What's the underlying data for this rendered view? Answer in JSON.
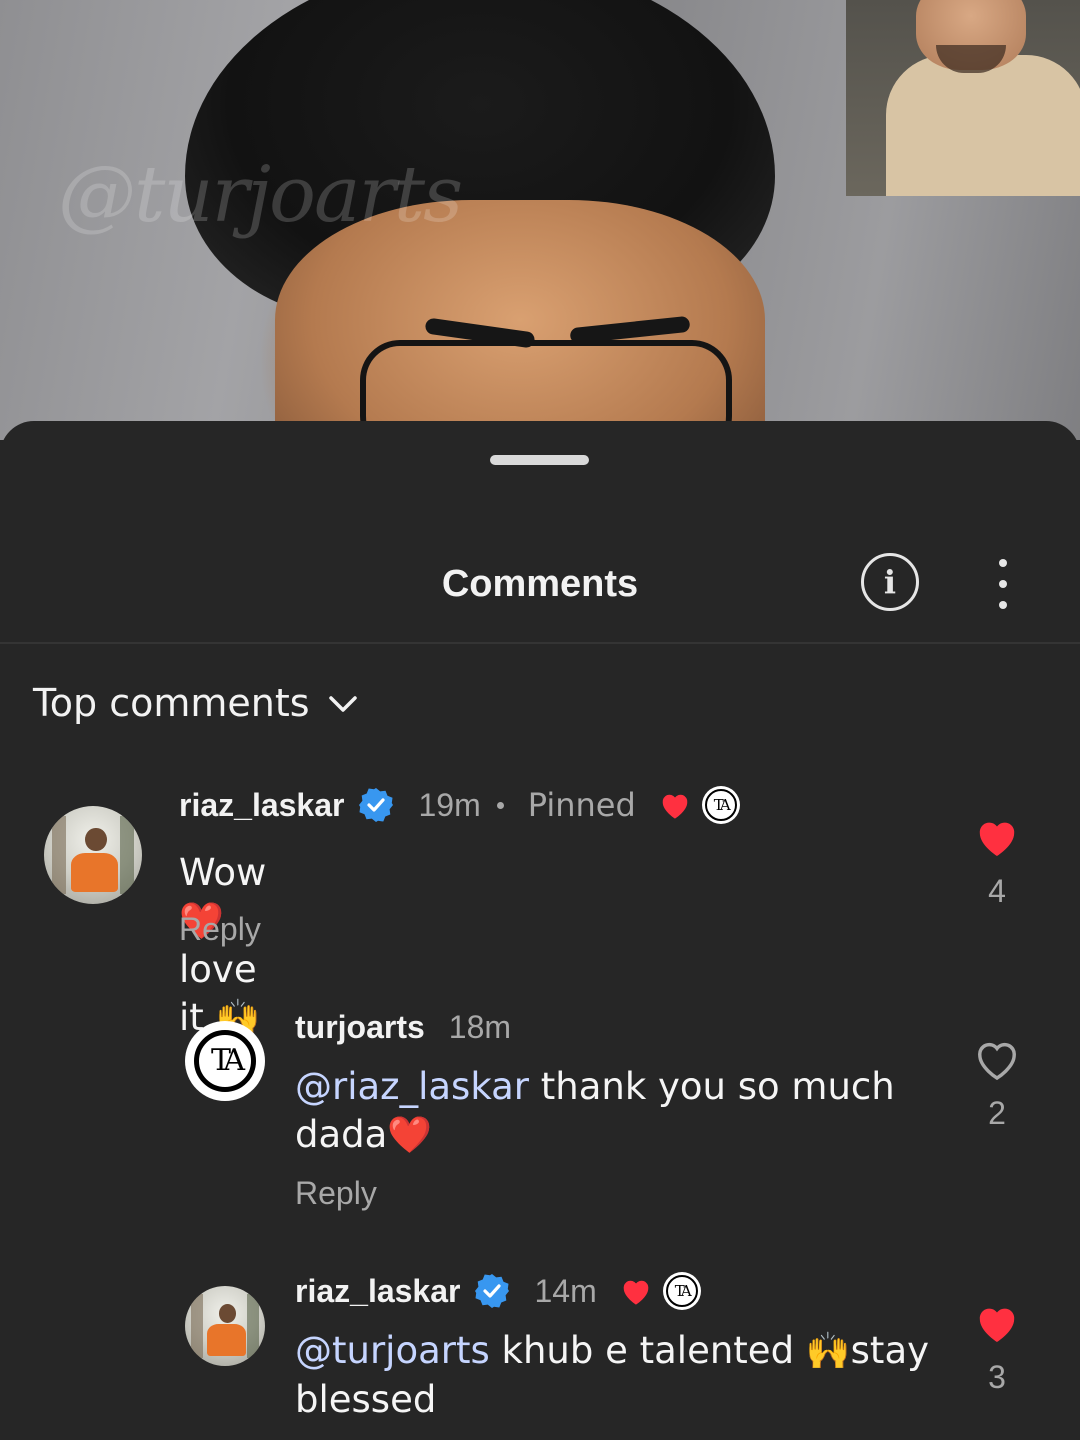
{
  "video": {
    "watermark": "@turjoarts"
  },
  "sheet": {
    "title": "Comments",
    "sort_label": "Top comments"
  },
  "comments": [
    {
      "username": "riaz_laskar",
      "verified": true,
      "time": "19m",
      "pinned_label": "Pinned",
      "creator_liked": true,
      "text_parts": [
        "Wow",
        "❤️",
        "love it ",
        "🙌"
      ],
      "reply_label": "Reply",
      "likes": "4",
      "liked": true
    },
    {
      "username": "turjoarts",
      "verified": false,
      "time": "18m",
      "mention": "@riaz_laskar",
      "text": " thank you so much dada",
      "emoji": "❤️",
      "reply_label": "Reply",
      "likes": "2",
      "liked": false
    },
    {
      "username": "riaz_laskar",
      "verified": true,
      "time": "14m",
      "creator_liked": true,
      "mention": "@turjoarts",
      "text": " khub e talented ",
      "emoji": "🙌",
      "text_after": "stay blessed",
      "likes": "3",
      "liked": true
    }
  ],
  "colors": {
    "background": "#262626",
    "like_red": "#ff3040",
    "verified_blue": "#3897f0",
    "mention": "#c6d5ff"
  },
  "creator_badge_text": "TA"
}
